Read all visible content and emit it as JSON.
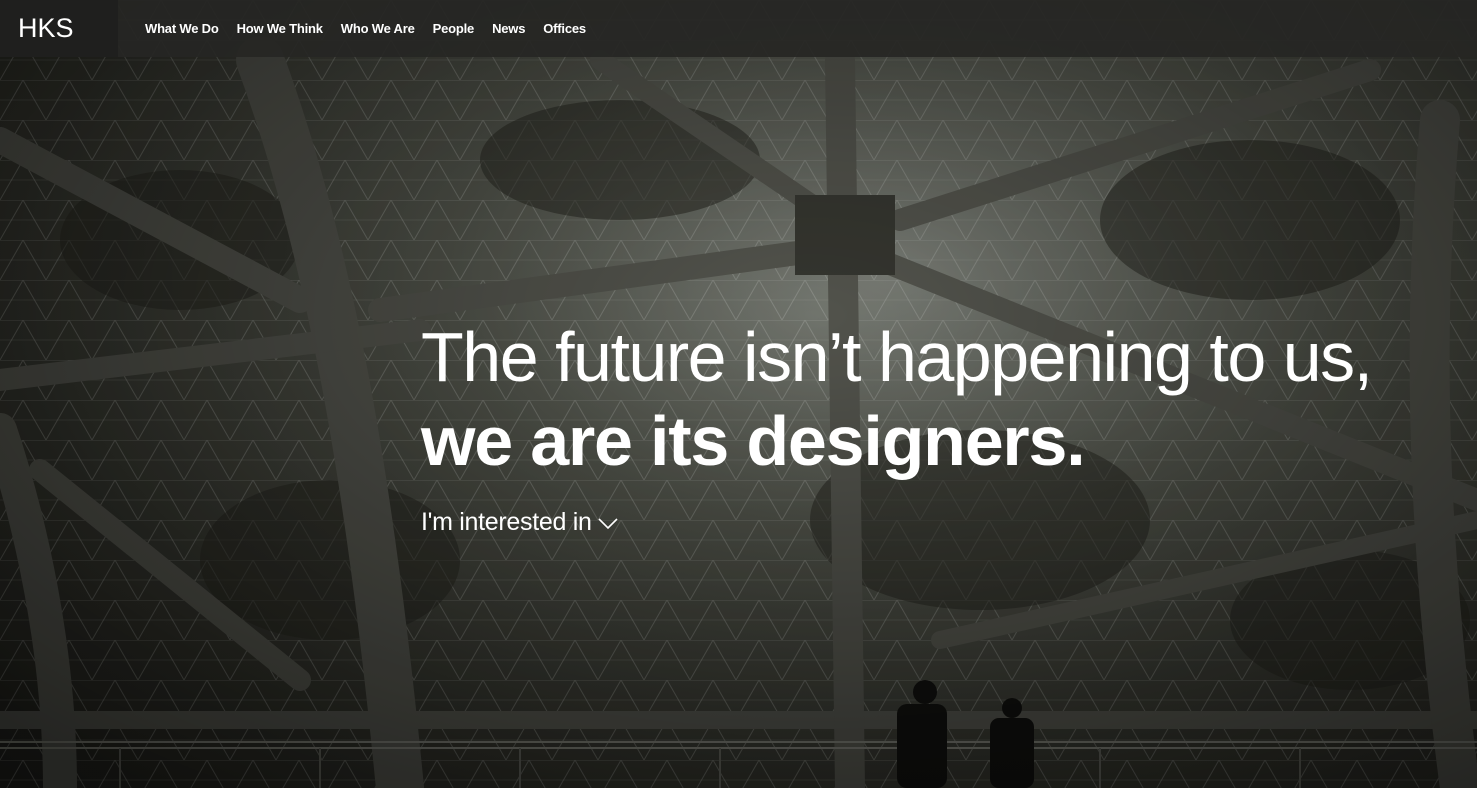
{
  "brand": {
    "logo_text": "HKS"
  },
  "nav": {
    "items": [
      {
        "label": "What We Do"
      },
      {
        "label": "How We Think"
      },
      {
        "label": "Who We Are"
      },
      {
        "label": "People"
      },
      {
        "label": "News"
      },
      {
        "label": "Offices"
      }
    ]
  },
  "hero": {
    "headline_line1": "The future isn’t happening to us,",
    "headline_line2": "we are its designers.",
    "interest_label": "I'm interested in",
    "interest_icon": "chevron-down-icon"
  },
  "colors": {
    "text": "#ffffff",
    "topbar": "#262624",
    "logo_box": "#1f1f1e"
  }
}
